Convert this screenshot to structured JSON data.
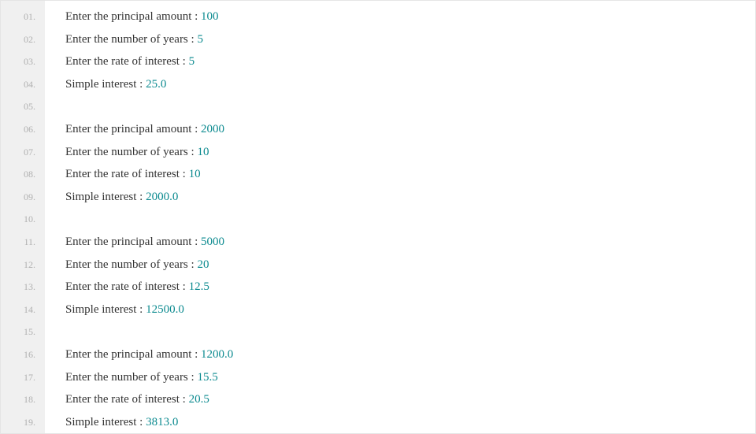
{
  "lines": [
    {
      "num": "01.",
      "segments": [
        {
          "t": "text",
          "v": "Enter the principal amount : "
        },
        {
          "t": "number",
          "v": "100"
        }
      ]
    },
    {
      "num": "02.",
      "segments": [
        {
          "t": "text",
          "v": "Enter the number of years : "
        },
        {
          "t": "number",
          "v": "5"
        }
      ]
    },
    {
      "num": "03.",
      "segments": [
        {
          "t": "text",
          "v": "Enter the rate of interest : "
        },
        {
          "t": "number",
          "v": "5"
        }
      ]
    },
    {
      "num": "04.",
      "segments": [
        {
          "t": "text",
          "v": "Simple interest : "
        },
        {
          "t": "number",
          "v": "25.0"
        }
      ]
    },
    {
      "num": "05.",
      "segments": []
    },
    {
      "num": "06.",
      "segments": [
        {
          "t": "text",
          "v": "Enter the principal amount : "
        },
        {
          "t": "number",
          "v": "2000"
        }
      ]
    },
    {
      "num": "07.",
      "segments": [
        {
          "t": "text",
          "v": "Enter the number of years : "
        },
        {
          "t": "number",
          "v": "10"
        }
      ]
    },
    {
      "num": "08.",
      "segments": [
        {
          "t": "text",
          "v": "Enter the rate of interest : "
        },
        {
          "t": "number",
          "v": "10"
        }
      ]
    },
    {
      "num": "09.",
      "segments": [
        {
          "t": "text",
          "v": "Simple interest : "
        },
        {
          "t": "number",
          "v": "2000.0"
        }
      ]
    },
    {
      "num": "10.",
      "segments": []
    },
    {
      "num": "11.",
      "segments": [
        {
          "t": "text",
          "v": "Enter the principal amount : "
        },
        {
          "t": "number",
          "v": "5000"
        }
      ]
    },
    {
      "num": "12.",
      "segments": [
        {
          "t": "text",
          "v": "Enter the number of years : "
        },
        {
          "t": "number",
          "v": "20"
        }
      ]
    },
    {
      "num": "13.",
      "segments": [
        {
          "t": "text",
          "v": "Enter the rate of interest : "
        },
        {
          "t": "number",
          "v": "12.5"
        }
      ]
    },
    {
      "num": "14.",
      "segments": [
        {
          "t": "text",
          "v": "Simple interest : "
        },
        {
          "t": "number",
          "v": "12500.0"
        }
      ]
    },
    {
      "num": "15.",
      "segments": []
    },
    {
      "num": "16.",
      "segments": [
        {
          "t": "text",
          "v": "Enter the principal amount : "
        },
        {
          "t": "number",
          "v": "1200.0"
        }
      ]
    },
    {
      "num": "17.",
      "segments": [
        {
          "t": "text",
          "v": "Enter the number of years : "
        },
        {
          "t": "number",
          "v": "15.5"
        }
      ]
    },
    {
      "num": "18.",
      "segments": [
        {
          "t": "text",
          "v": "Enter the rate of interest : "
        },
        {
          "t": "number",
          "v": "20.5"
        }
      ]
    },
    {
      "num": "19.",
      "segments": [
        {
          "t": "text",
          "v": "Simple interest : "
        },
        {
          "t": "number",
          "v": "3813.0"
        }
      ]
    }
  ]
}
